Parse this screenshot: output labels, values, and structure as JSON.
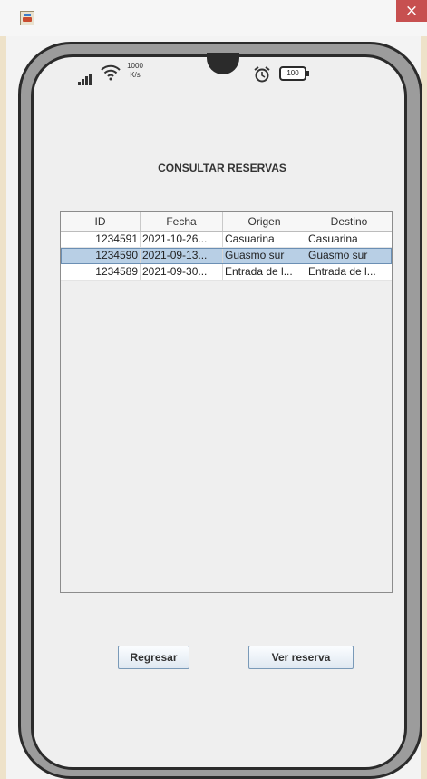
{
  "window": {
    "close_glyph": "×"
  },
  "status_bar": {
    "net_speed_value": "1000",
    "net_speed_unit": "K/s",
    "battery": "100"
  },
  "page": {
    "title": "CONSULTAR RESERVAS"
  },
  "table": {
    "columns": [
      "ID",
      "Fecha",
      "Origen",
      "Destino"
    ],
    "rows": [
      {
        "id": "1234591",
        "fecha": "2021-10-26...",
        "origen": "Casuarina",
        "destino": "Casuarina"
      },
      {
        "id": "1234590",
        "fecha": "2021-09-13...",
        "origen": "Guasmo sur",
        "destino": "Guasmo sur"
      },
      {
        "id": "1234589",
        "fecha": "2021-09-30...",
        "origen": "Entrada de l...",
        "destino": "Entrada de l..."
      }
    ]
  },
  "buttons": {
    "back": "Regresar",
    "view": "Ver reserva"
  }
}
